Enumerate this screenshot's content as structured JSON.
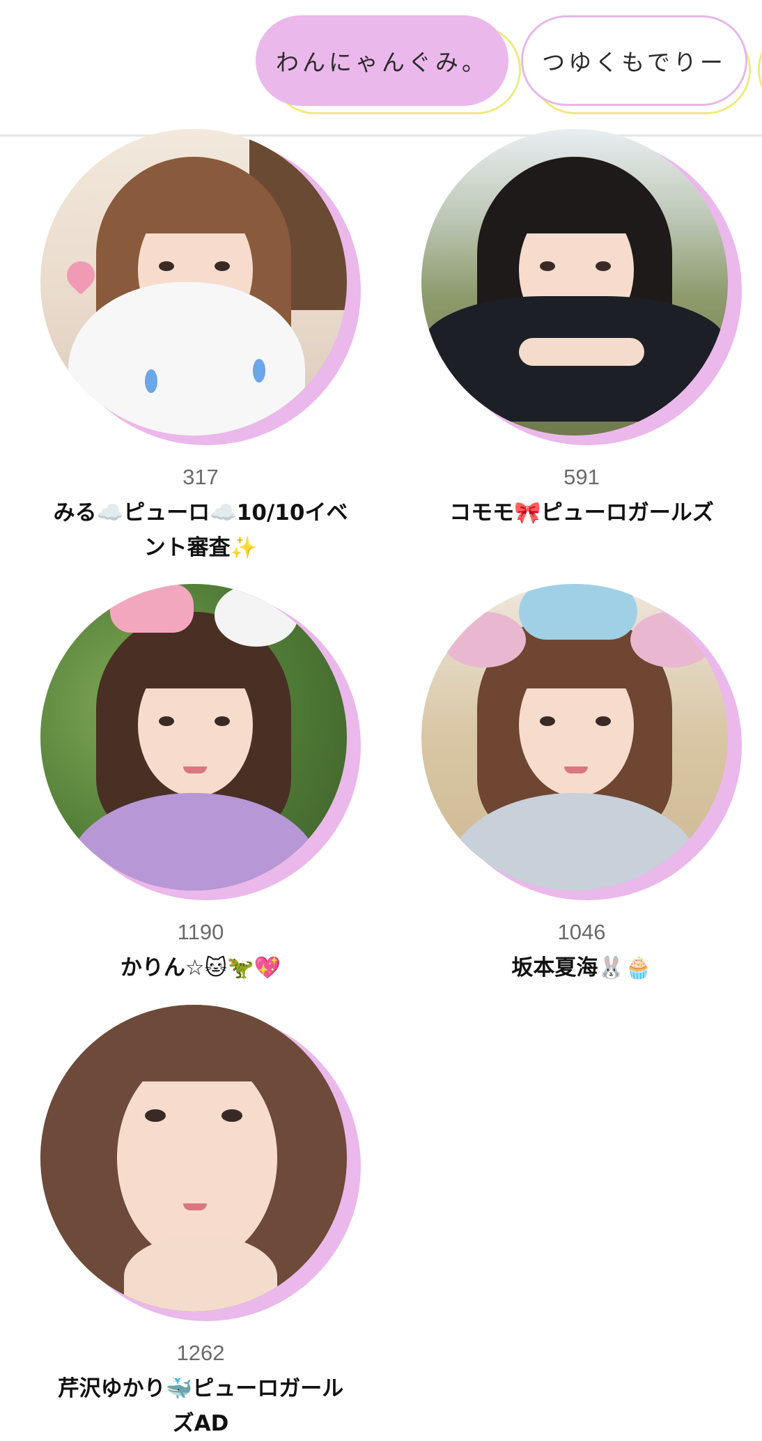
{
  "tabs": [
    {
      "label": "わんにゃんぐみ。",
      "active": true
    },
    {
      "label": "つゆくもでりー",
      "active": false
    }
  ],
  "members": [
    {
      "count": "317",
      "name": "みる☁️ピューロ☁️10/10イベント審査✨"
    },
    {
      "count": "591",
      "name": "コモモ🎀ピューロガールズ"
    },
    {
      "count": "1190",
      "name": "かりん☆🐱🦖💖"
    },
    {
      "count": "1046",
      "name": "坂本夏海🐰🧁"
    },
    {
      "count": "1262",
      "name": "芹沢ゆかり🐳ピューロガールズAD"
    }
  ],
  "colors": {
    "accent_pink": "#ebb8eb",
    "accent_yellow": "#eeea80",
    "divider": "#e6e6e6"
  }
}
